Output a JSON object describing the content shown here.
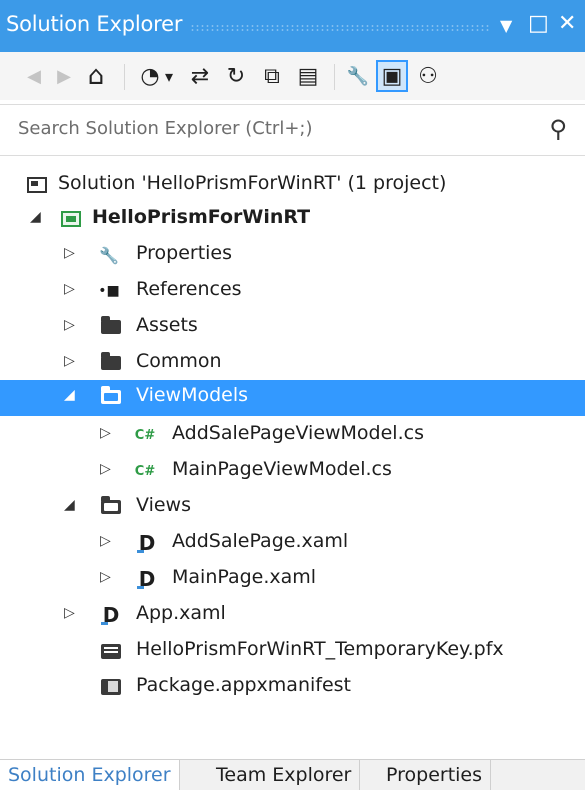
{
  "window": {
    "title": "Solution Explorer",
    "controls": {
      "dropdown": "▼",
      "maximize": "□",
      "close": "✕"
    }
  },
  "toolbar": {
    "buttons": [
      {
        "name": "back-icon",
        "glyph": "◀"
      },
      {
        "name": "forward-icon",
        "glyph": "▶"
      },
      {
        "name": "home-icon",
        "glyph": "⌂"
      },
      {
        "name": "pending-changes-filter-icon",
        "glyph": "◔"
      },
      {
        "name": "dropdown-arrow-icon",
        "glyph": "▾"
      },
      {
        "name": "sync-with-active-document-icon",
        "glyph": "⇄"
      },
      {
        "name": "refresh-icon",
        "glyph": "↻"
      },
      {
        "name": "collapse-all-icon",
        "glyph": "⧉"
      },
      {
        "name": "show-all-files-icon",
        "glyph": "▤"
      },
      {
        "name": "properties-wrench-icon",
        "glyph": "🔧"
      },
      {
        "name": "preview-selected-items-icon",
        "glyph": "▣"
      },
      {
        "name": "class-view-icon",
        "glyph": "⚇"
      }
    ]
  },
  "search": {
    "placeholder": "Search Solution Explorer (Ctrl+;)",
    "icon": "search-icon",
    "icon_glyph": "⚲"
  },
  "tree": {
    "solution": {
      "label": "Solution 'HelloPrismForWinRT' (1 project)",
      "icon": "solution-icon"
    },
    "project": {
      "label": "HelloPrismForWinRT",
      "icon": "project-icon",
      "expanded": true
    },
    "items": [
      {
        "label": "Properties",
        "icon": "wrench-icon",
        "expanded": false
      },
      {
        "label": "References",
        "icon": "references-icon",
        "expanded": false
      },
      {
        "label": "Assets",
        "icon": "folder-icon",
        "expanded": false
      },
      {
        "label": "Common",
        "icon": "folder-icon",
        "expanded": false
      },
      {
        "label": "ViewModels",
        "icon": "folder-open-icon",
        "expanded": true,
        "selected": true
      },
      {
        "label": "AddSalePageViewModel.cs",
        "icon": "csharp-file-icon",
        "expanded": false
      },
      {
        "label": "MainPageViewModel.cs",
        "icon": "csharp-file-icon",
        "expanded": false
      },
      {
        "label": "Views",
        "icon": "folder-open-icon",
        "expanded": true
      },
      {
        "label": "AddSalePage.xaml",
        "icon": "xaml-file-icon",
        "expanded": false
      },
      {
        "label": "MainPage.xaml",
        "icon": "xaml-file-icon",
        "expanded": false
      },
      {
        "label": "App.xaml",
        "icon": "xaml-file-icon",
        "expanded": false
      },
      {
        "label": "HelloPrismForWinRT_TemporaryKey.pfx",
        "icon": "certificate-file-icon"
      },
      {
        "label": "Package.appxmanifest",
        "icon": "manifest-file-icon"
      }
    ],
    "cs_glyph": "C#",
    "xaml_glyph": "D",
    "references_glyph": "•■",
    "wrench_glyph": "🔧",
    "expanded_glyph": "◢",
    "collapsed_glyph": "▷"
  },
  "bottom_tabs": [
    {
      "label": "Solution Explorer",
      "active": true
    },
    {
      "label": "Team Explorer",
      "active": false
    },
    {
      "label": "Properties",
      "active": false
    }
  ],
  "colors": {
    "title_bar": "#3c9ae8",
    "selection": "#3399ff",
    "csharp_icon": "#2e9b46",
    "active_tab_text": "#3e80c5"
  }
}
